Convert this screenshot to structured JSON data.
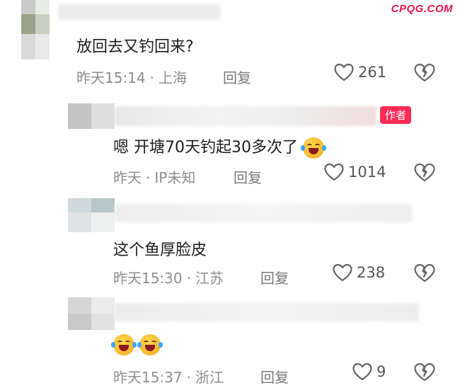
{
  "watermark": "CPQG.COM",
  "colors": {
    "watermark": "#e8124f",
    "author_badge": "#fe2c55",
    "meta_text": "#8e8e8e"
  },
  "comments": [
    {
      "text": "放回去又钓回来?",
      "date": "昨天15:14",
      "location": "上海",
      "reply_label": "回复",
      "likes": "261",
      "like_icon": "heart-outline-icon",
      "dislike_icon": "broken-heart-icon"
    },
    {
      "author_badge": "作者",
      "text": "嗯 开塘70天钓起30多次了",
      "date": "昨天",
      "location": "IP未知",
      "reply_label": "回复",
      "likes": "1014",
      "emoji": "laughing-crying-emoji"
    },
    {
      "text": "这个鱼厚脸皮",
      "date": "昨天15:30",
      "location": "江苏",
      "reply_label": "回复",
      "likes": "238"
    },
    {
      "text": "",
      "emoji_count": 2,
      "date": "昨天15:37",
      "location": "浙江",
      "reply_label": "回复",
      "likes": "9"
    }
  ],
  "separator": "·"
}
